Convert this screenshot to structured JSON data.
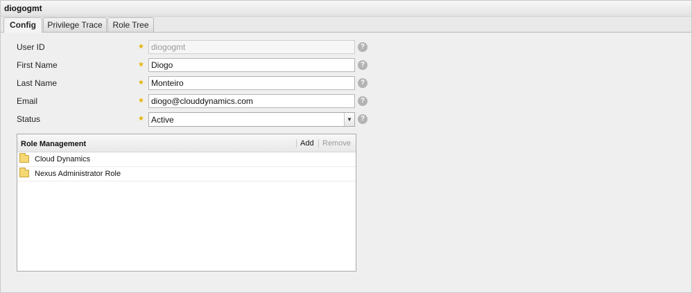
{
  "window": {
    "title": "diogogmt"
  },
  "tabs": [
    {
      "label": "Config",
      "active": true
    },
    {
      "label": "Privilege Trace",
      "active": false
    },
    {
      "label": "Role Tree",
      "active": false
    }
  ],
  "form": {
    "user_id": {
      "label": "User ID",
      "value": "diogogmt",
      "disabled": true
    },
    "first_name": {
      "label": "First Name",
      "value": "Diogo"
    },
    "last_name": {
      "label": "Last Name",
      "value": "Monteiro"
    },
    "email": {
      "label": "Email",
      "value": "diogo@clouddynamics.com"
    },
    "status": {
      "label": "Status",
      "value": "Active"
    },
    "required_marker": "★",
    "help_glyph": "?"
  },
  "roles": {
    "title": "Role Management",
    "add_label": "Add",
    "remove_label": "Remove",
    "items": [
      {
        "label": "Cloud Dynamics"
      },
      {
        "label": "Nexus Administrator Role"
      }
    ]
  },
  "colors": {
    "required_star": "#e5b300",
    "disabled_text": "#999999",
    "folder": "#f5d773"
  }
}
